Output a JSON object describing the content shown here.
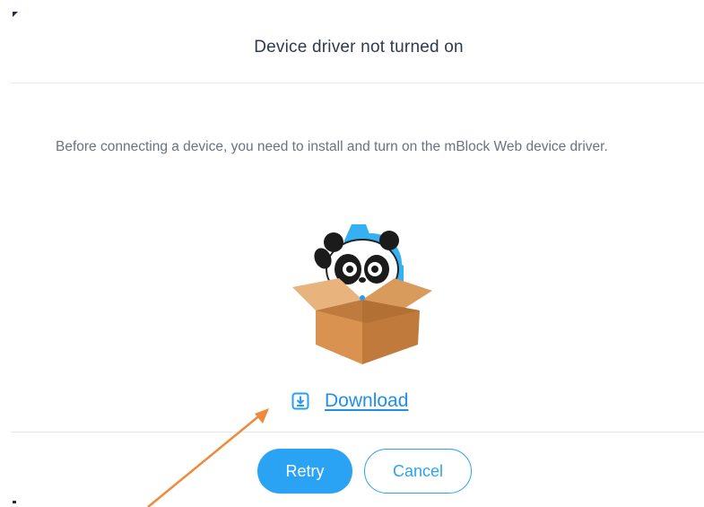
{
  "dialog": {
    "title": "Device driver not turned on",
    "message": "Before connecting a device, you need to install and turn on the mBlock Web device driver.",
    "download_label": "Download",
    "retry_label": "Retry",
    "cancel_label": "Cancel"
  },
  "icons": {
    "download": "download-icon",
    "illustration": "panda-in-box-illustration"
  },
  "colors": {
    "accent": "#2ba3f5",
    "link": "#1f8fe8",
    "title_text": "#2f3a4f",
    "body_text": "#6b7280",
    "annotation_arrow": "#ef8a3c"
  }
}
